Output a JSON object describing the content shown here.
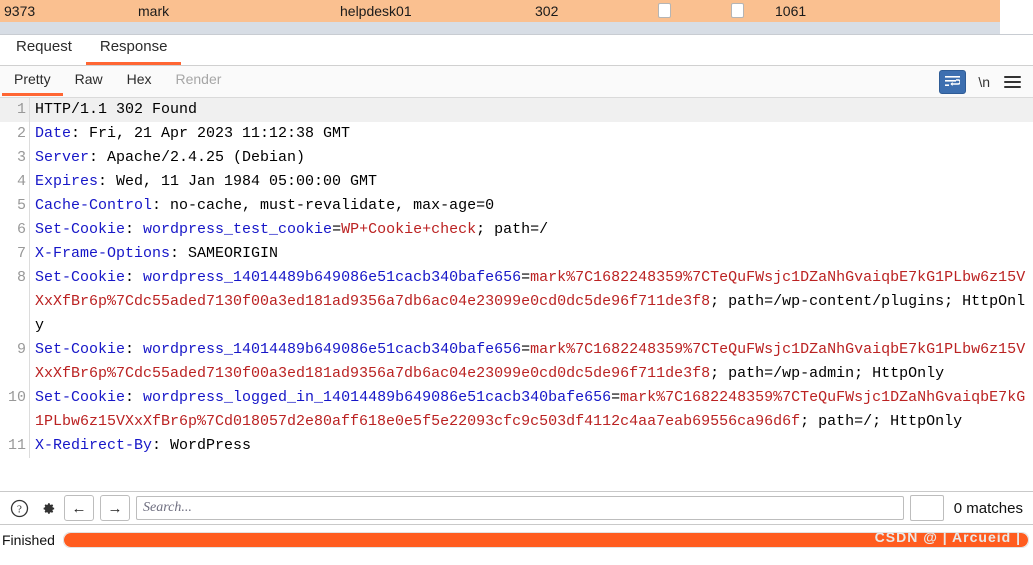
{
  "proxy_row": {
    "id": "9373",
    "user": "mark",
    "host": "helpdesk01",
    "status": "302",
    "length": "1061"
  },
  "message_tabs": [
    {
      "label": "Request",
      "active": false
    },
    {
      "label": "Response",
      "active": true
    }
  ],
  "view_tabs": [
    {
      "label": "Pretty",
      "active": true,
      "disabled": false
    },
    {
      "label": "Raw",
      "active": false,
      "disabled": false
    },
    {
      "label": "Hex",
      "active": false,
      "disabled": false
    },
    {
      "label": "Render",
      "active": false,
      "disabled": true
    }
  ],
  "view_tools": {
    "wrap_icon": "line-wrap-icon",
    "newline_label": "\\n",
    "menu_icon": "hamburger-menu-icon"
  },
  "response": {
    "lines": [
      {
        "n": "1",
        "highlight": true,
        "parts": [
          {
            "t": "HTTP/1.1 302 Found",
            "c": "v"
          }
        ]
      },
      {
        "n": "2",
        "highlight": false,
        "parts": [
          {
            "t": "Date",
            "c": "k"
          },
          {
            "t": ": Fri, 21 Apr 2023 11:12:38 GMT",
            "c": "v"
          }
        ]
      },
      {
        "n": "3",
        "highlight": false,
        "parts": [
          {
            "t": "Server",
            "c": "k"
          },
          {
            "t": ": Apache/2.4.25 (Debian)",
            "c": "v"
          }
        ]
      },
      {
        "n": "4",
        "highlight": false,
        "parts": [
          {
            "t": "Expires",
            "c": "k"
          },
          {
            "t": ": Wed, 11 Jan 1984 05:00:00 GMT",
            "c": "v"
          }
        ]
      },
      {
        "n": "5",
        "highlight": false,
        "parts": [
          {
            "t": "Cache-Control",
            "c": "k"
          },
          {
            "t": ": no-cache, must-revalidate, max-age=0",
            "c": "v"
          }
        ]
      },
      {
        "n": "6",
        "highlight": false,
        "parts": [
          {
            "t": "Set-Cookie",
            "c": "k"
          },
          {
            "t": ": ",
            "c": "v"
          },
          {
            "t": "wordpress_test_cookie",
            "c": "ck"
          },
          {
            "t": "=",
            "c": "v"
          },
          {
            "t": "WP+Cookie+check",
            "c": "cv"
          },
          {
            "t": "; path=/",
            "c": "v"
          }
        ]
      },
      {
        "n": "7",
        "highlight": false,
        "parts": [
          {
            "t": "X-Frame-Options",
            "c": "k"
          },
          {
            "t": ": SAMEORIGIN",
            "c": "v"
          }
        ]
      },
      {
        "n": "8",
        "highlight": false,
        "parts": [
          {
            "t": "Set-Cookie",
            "c": "k"
          },
          {
            "t": ": ",
            "c": "v"
          },
          {
            "t": "wordpress_14014489b649086e51cacb340bafe656",
            "c": "ck"
          },
          {
            "t": "=",
            "c": "v"
          },
          {
            "t": "mark%7C1682248359%7CTeQuFWsjc1DZaNhGvaiqbE7kG1PLbw6z15VXxXfBr6p%7Cdc55aded7130f00a3ed181ad9356a7db6ac04e23099e0cd0dc5de96f711de3f8",
            "c": "cv"
          },
          {
            "t": "; path=/wp-content/plugins; HttpOnly",
            "c": "v"
          }
        ]
      },
      {
        "n": "9",
        "highlight": false,
        "parts": [
          {
            "t": "Set-Cookie",
            "c": "k"
          },
          {
            "t": ": ",
            "c": "v"
          },
          {
            "t": "wordpress_14014489b649086e51cacb340bafe656",
            "c": "ck"
          },
          {
            "t": "=",
            "c": "v"
          },
          {
            "t": "mark%7C1682248359%7CTeQuFWsjc1DZaNhGvaiqbE7kG1PLbw6z15VXxXfBr6p%7Cdc55aded7130f00a3ed181ad9356a7db6ac04e23099e0cd0dc5de96f711de3f8",
            "c": "cv"
          },
          {
            "t": "; path=/wp-admin; HttpOnly",
            "c": "v"
          }
        ]
      },
      {
        "n": "10",
        "highlight": false,
        "parts": [
          {
            "t": "Set-Cookie",
            "c": "k"
          },
          {
            "t": ": ",
            "c": "v"
          },
          {
            "t": "wordpress_logged_in_14014489b649086e51cacb340bafe656",
            "c": "ck"
          },
          {
            "t": "=",
            "c": "v"
          },
          {
            "t": "mark%7C1682248359%7CTeQuFWsjc1DZaNhGvaiqbE7kG1PLbw6z15VXxXfBr6p%7Cd018057d2e80aff618e0e5f5e22093cfc9c503df4112c4aa7eab69556ca96d6f",
            "c": "cv"
          },
          {
            "t": "; path=/; HttpOnly",
            "c": "v"
          }
        ]
      },
      {
        "n": "11",
        "highlight": false,
        "parts": [
          {
            "t": "X-Redirect-By",
            "c": "k"
          },
          {
            "t": ": WordPress",
            "c": "v"
          }
        ]
      }
    ]
  },
  "find_bar": {
    "help_icon": "help-question-icon",
    "settings_icon": "gear-icon",
    "prev_icon": "←",
    "next_icon": "→",
    "search_value": "",
    "search_placeholder": "Search...",
    "matches_label": "0 matches"
  },
  "status_bar": {
    "status": "Finished",
    "progress_percent": 100,
    "watermark": "CSDN @ | Arcueid |"
  },
  "colors": {
    "accent": "#ff6633",
    "header_name": "#1616c8",
    "cookie_value": "#bb2222",
    "row_highlight": "#fac090",
    "progress": "#ff5c1f",
    "wrap_button": "#3d6fb0"
  }
}
